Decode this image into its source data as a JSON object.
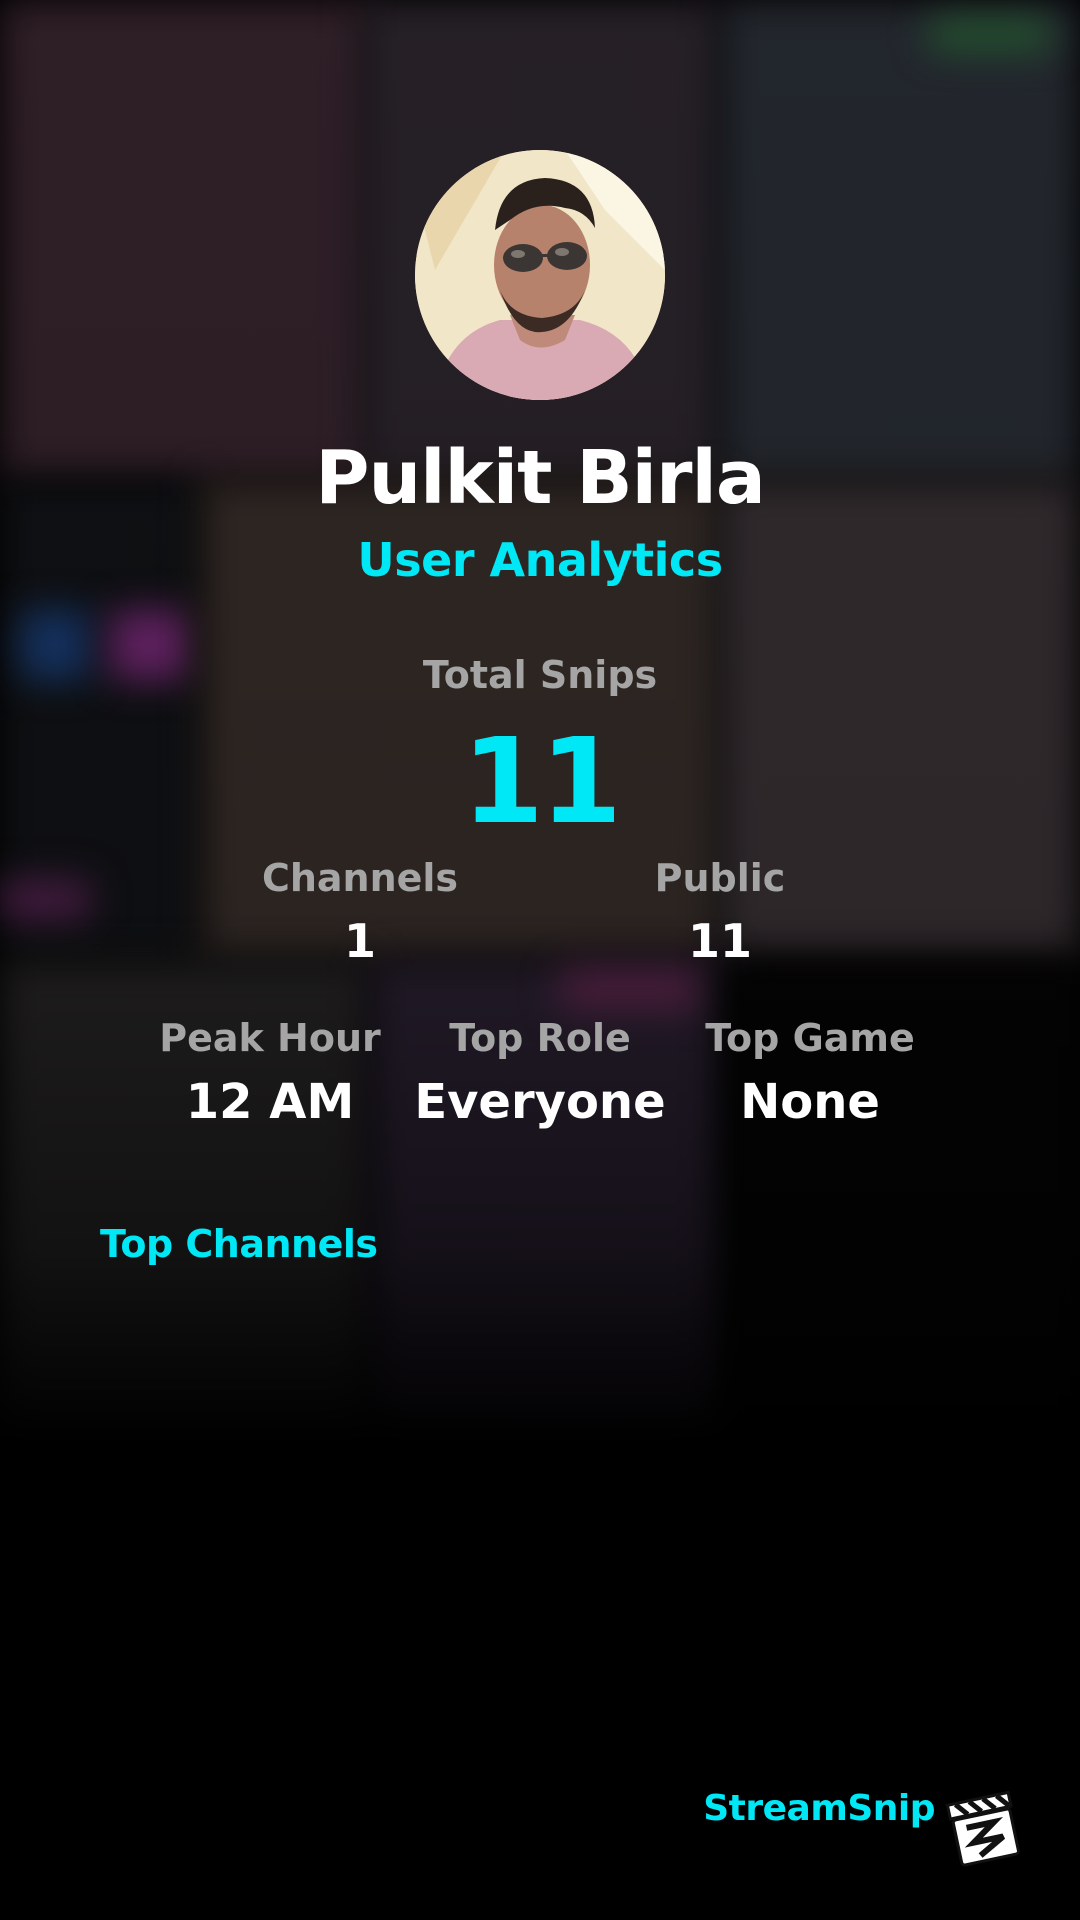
{
  "profile": {
    "name": "Pulkit Birla",
    "subtitle": "User Analytics"
  },
  "stats": {
    "total_snips": {
      "label": "Total Snips",
      "value": "11"
    },
    "channels": {
      "label": "Channels",
      "value": "1"
    },
    "public": {
      "label": "Public",
      "value": "11"
    },
    "peak_hour": {
      "label": "Peak Hour",
      "value": "12 AM"
    },
    "top_role": {
      "label": "Top Role",
      "value": "Everyone"
    },
    "top_game": {
      "label": "Top Game",
      "value": "None"
    }
  },
  "sections": {
    "top_channels_title": "Top Channels"
  },
  "brand": {
    "name": "StreamSnip",
    "logo_icon": "clapperboard-icon"
  },
  "colors": {
    "accent": "#00e7f5",
    "label": "#a5a5a5",
    "value": "#ffffff",
    "background": "#000000"
  }
}
